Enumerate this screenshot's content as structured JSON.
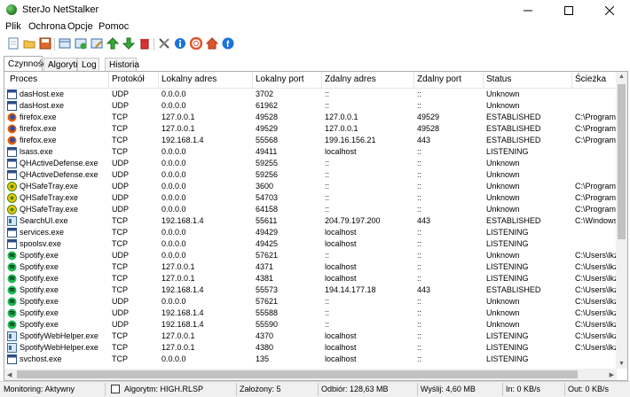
{
  "window": {
    "title": "SterJo NetStalker"
  },
  "menu": [
    "Plik",
    "Ochrona",
    "Opcje",
    "Pomoc"
  ],
  "tabs": [
    "Czynność",
    "Algorytm",
    "Log",
    "Historia"
  ],
  "columns": [
    "Proces",
    "Protokół",
    "Lokalny adres",
    "Lokalny port",
    "Zdalny adres",
    "Zdalny port",
    "Status",
    "Ścieżka"
  ],
  "rows": [
    {
      "icon": "window",
      "proc": "dasHost.exe",
      "proto": "UDP",
      "laddr": "0.0.0.0",
      "lport": "3702",
      "raddr": "::",
      "rport": "::",
      "status": "Unknown",
      "path": ""
    },
    {
      "icon": "window",
      "proc": "dasHost.exe",
      "proto": "UDP",
      "laddr": "0.0.0.0",
      "lport": "61962",
      "raddr": "::",
      "rport": "::",
      "status": "Unknown",
      "path": ""
    },
    {
      "icon": "firefox",
      "proc": "firefox.exe",
      "proto": "TCP",
      "laddr": "127.0.0.1",
      "lport": "49528",
      "raddr": "127.0.0.1",
      "rport": "49529",
      "status": "ESTABLISHED",
      "path": "C:\\Program F"
    },
    {
      "icon": "firefox",
      "proc": "firefox.exe",
      "proto": "TCP",
      "laddr": "127.0.0.1",
      "lport": "49529",
      "raddr": "127.0.0.1",
      "rport": "49528",
      "status": "ESTABLISHED",
      "path": "C:\\Program F"
    },
    {
      "icon": "firefox",
      "proc": "firefox.exe",
      "proto": "TCP",
      "laddr": "192.168.1.4",
      "lport": "55568",
      "raddr": "199.16.156.21",
      "rport": "443",
      "status": "ESTABLISHED",
      "path": "C:\\Program F"
    },
    {
      "icon": "window",
      "proc": "lsass.exe",
      "proto": "TCP",
      "laddr": "0.0.0.0",
      "lport": "49411",
      "raddr": "localhost",
      "rport": "::",
      "status": "LISTENING",
      "path": ""
    },
    {
      "icon": "window",
      "proc": "QHActiveDefense.exe",
      "proto": "UDP",
      "laddr": "0.0.0.0",
      "lport": "59255",
      "raddr": "::",
      "rport": "::",
      "status": "Unknown",
      "path": ""
    },
    {
      "icon": "window",
      "proc": "QHActiveDefense.exe",
      "proto": "UDP",
      "laddr": "0.0.0.0",
      "lport": "59256",
      "raddr": "::",
      "rport": "::",
      "status": "Unknown",
      "path": ""
    },
    {
      "icon": "qhsafe",
      "proc": "QHSafeTray.exe",
      "proto": "UDP",
      "laddr": "0.0.0.0",
      "lport": "3600",
      "raddr": "::",
      "rport": "::",
      "status": "Unknown",
      "path": "C:\\Program F"
    },
    {
      "icon": "qhsafe",
      "proc": "QHSafeTray.exe",
      "proto": "UDP",
      "laddr": "0.0.0.0",
      "lport": "54703",
      "raddr": "::",
      "rport": "::",
      "status": "Unknown",
      "path": "C:\\Program F"
    },
    {
      "icon": "qhsafe",
      "proc": "QHSafeTray.exe",
      "proto": "UDP",
      "laddr": "0.0.0.0",
      "lport": "64158",
      "raddr": "::",
      "rport": "::",
      "status": "Unknown",
      "path": "C:\\Program F"
    },
    {
      "icon": "searchui",
      "proc": "SearchUI.exe",
      "proto": "TCP",
      "laddr": "192.168.1.4",
      "lport": "55611",
      "raddr": "204.79.197.200",
      "rport": "443",
      "status": "ESTABLISHED",
      "path": "C:\\Windows\\"
    },
    {
      "icon": "window",
      "proc": "services.exe",
      "proto": "TCP",
      "laddr": "0.0.0.0",
      "lport": "49429",
      "raddr": "localhost",
      "rport": "::",
      "status": "LISTENING",
      "path": ""
    },
    {
      "icon": "window",
      "proc": "spoolsv.exe",
      "proto": "TCP",
      "laddr": "0.0.0.0",
      "lport": "49425",
      "raddr": "localhost",
      "rport": "::",
      "status": "LISTENING",
      "path": ""
    },
    {
      "icon": "spotify",
      "proc": "Spotify.exe",
      "proto": "UDP",
      "laddr": "0.0.0.0",
      "lport": "57621",
      "raddr": "::",
      "rport": "::",
      "status": "Unknown",
      "path": "C:\\Users\\lkz"
    },
    {
      "icon": "spotify",
      "proc": "Spotify.exe",
      "proto": "TCP",
      "laddr": "127.0.0.1",
      "lport": "4371",
      "raddr": "localhost",
      "rport": "::",
      "status": "LISTENING",
      "path": "C:\\Users\\lkz"
    },
    {
      "icon": "spotify",
      "proc": "Spotify.exe",
      "proto": "TCP",
      "laddr": "127.0.0.1",
      "lport": "4381",
      "raddr": "localhost",
      "rport": "::",
      "status": "LISTENING",
      "path": "C:\\Users\\lkz"
    },
    {
      "icon": "spotify",
      "proc": "Spotify.exe",
      "proto": "TCP",
      "laddr": "192.168.1.4",
      "lport": "55573",
      "raddr": "194.14.177.18",
      "rport": "443",
      "status": "ESTABLISHED",
      "path": "C:\\Users\\lkz"
    },
    {
      "icon": "spotify",
      "proc": "Spotify.exe",
      "proto": "UDP",
      "laddr": "0.0.0.0",
      "lport": "57621",
      "raddr": "::",
      "rport": "::",
      "status": "Unknown",
      "path": "C:\\Users\\lkz"
    },
    {
      "icon": "spotify",
      "proc": "Spotify.exe",
      "proto": "UDP",
      "laddr": "192.168.1.4",
      "lport": "55588",
      "raddr": "::",
      "rport": "::",
      "status": "Unknown",
      "path": "C:\\Users\\lkz"
    },
    {
      "icon": "spotify",
      "proc": "Spotify.exe",
      "proto": "UDP",
      "laddr": "192.168.1.4",
      "lport": "55590",
      "raddr": "::",
      "rport": "::",
      "status": "Unknown",
      "path": "C:\\Users\\lkz"
    },
    {
      "icon": "searchui",
      "proc": "SpotifyWebHelper.exe",
      "proto": "TCP",
      "laddr": "127.0.0.1",
      "lport": "4370",
      "raddr": "localhost",
      "rport": "::",
      "status": "LISTENING",
      "path": "C:\\Users\\lkz"
    },
    {
      "icon": "searchui",
      "proc": "SpotifyWebHelper.exe",
      "proto": "TCP",
      "laddr": "127.0.0.1",
      "lport": "4380",
      "raddr": "localhost",
      "rport": "::",
      "status": "LISTENING",
      "path": "C:\\Users\\lkz"
    },
    {
      "icon": "window",
      "proc": "svchost.exe",
      "proto": "TCP",
      "laddr": "0.0.0.0",
      "lport": "135",
      "raddr": "localhost",
      "rport": "::",
      "status": "LISTENING",
      "path": ""
    }
  ],
  "status": {
    "monitoring": "Monitoring: Aktywny",
    "algorithm": "Algorytm: HIGH.RLSP",
    "installed": "Założony: 5",
    "received": "Odbiór: 128,63 MB",
    "sent": "Wyślij: 4,60 MB",
    "in": "In: 0 KB/s",
    "out": "Out: 0 KB/s"
  },
  "colors": {
    "accent": "#0078d7",
    "status_bg": "#f0f0f0"
  },
  "toolbar_icons": [
    "new-icon",
    "open-icon",
    "save-icon",
    "view-icon",
    "add-icon",
    "edit-icon",
    "move-up-icon",
    "move-down-icon",
    "delete-icon",
    "tools-icon",
    "info-icon",
    "help-icon",
    "home-icon",
    "facebook-icon"
  ]
}
